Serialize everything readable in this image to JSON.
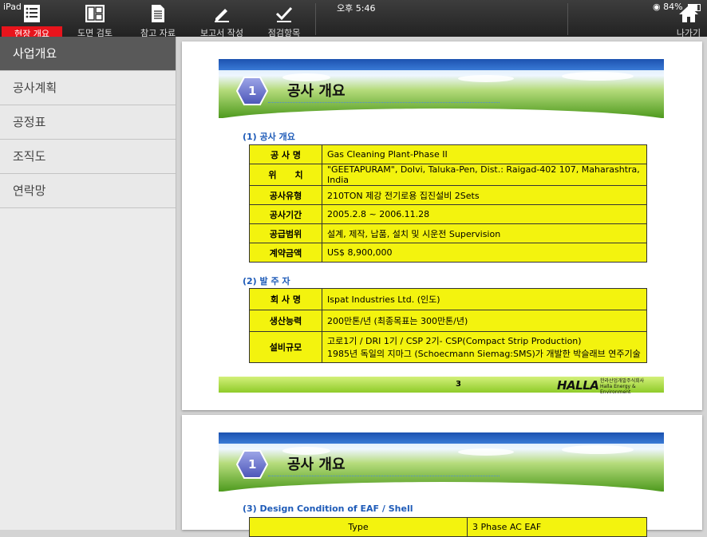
{
  "status": {
    "device": "iPad",
    "time": "오후 5:46",
    "battery": "84%"
  },
  "toolbar": {
    "tabs": [
      {
        "label": "현장 개요"
      },
      {
        "label": "도면 검토"
      },
      {
        "label": "참고 자료"
      },
      {
        "label": "보고서 작성"
      },
      {
        "label": "점검항목"
      }
    ],
    "exit_label": "나가기"
  },
  "sidebar": {
    "items": [
      {
        "label": "사업개요"
      },
      {
        "label": "공사계획"
      },
      {
        "label": "공정표"
      },
      {
        "label": "조직도"
      },
      {
        "label": "연락망"
      }
    ]
  },
  "page1": {
    "badge": "1",
    "title": "공사 개요",
    "section1": "(1) 공사 개요",
    "table1": [
      {
        "k": "공 사 명",
        "v": "Gas Cleaning Plant-Phase II"
      },
      {
        "k": "위      치",
        "v": "\"GEETAPURAM\", Dolvi, Taluka-Pen, Dist.: Raigad-402 107, Maharashtra, India"
      },
      {
        "k": "공사유형",
        "v": "210TON 제강 전기로용 집진설비 2Sets"
      },
      {
        "k": "공사기간",
        "v": "2005.2.8 ~ 2006.11.28"
      },
      {
        "k": "공급범위",
        "v": "설계, 제작, 납품, 설치 및 시운전 Supervision"
      },
      {
        "k": "계약금액",
        "v": "US$ 8,900,000"
      }
    ],
    "section2": "(2) 발 주 자",
    "table2": [
      {
        "k": "회 사 명",
        "v": "Ispat Industries Ltd. (인도)"
      },
      {
        "k": "생산능력",
        "v": "200만톤/년 (최종목표는 300만톤/년)"
      },
      {
        "k": "설비규모",
        "v1": "고로1기 / DRI 1기 / CSP 2기- CSP(Compact Strip Production)",
        "v2": "1985년 독일의 지마그 (Schoecmann Siemag:SMS)가 개발한 박슬래브 연주기술"
      }
    ],
    "page_number": "3",
    "logo": "HALLA",
    "logo_sub1": "한라산업개발주식회사",
    "logo_sub2": "Halla Energy & Environment"
  },
  "page2": {
    "badge": "1",
    "title": "공사 개요",
    "section3": "(3) Design Condition of EAF / Shell",
    "row_key": "Type",
    "row_val": "3 Phase AC EAF"
  },
  "colors": {
    "accent": "#e8141c",
    "table_fill": "#f3f30e",
    "section_blue": "#1e5bb8"
  }
}
